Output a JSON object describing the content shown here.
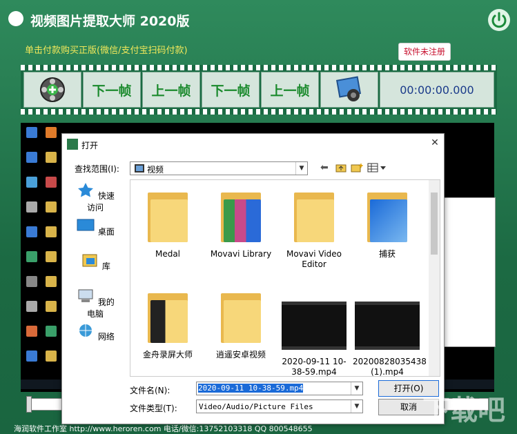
{
  "app": {
    "title": "视频图片提取大师  2020版",
    "pay_link": "单击付款购买正版(微信/支付宝扫码付款)",
    "register_badge": "软件未注册",
    "footer": "海润软件工作室 http://www.heroren.com  电话/微信:13752103318  QQ 800548655",
    "watermark": "下载吧"
  },
  "toolbar": {
    "next_frame_1": "下一帧",
    "prev_frame_1": "上一帧",
    "next_frame_2": "下一帧",
    "prev_frame_2": "上一帧",
    "timecode": "00:00:00.000"
  },
  "dialog": {
    "title": "打开",
    "look_in_label": "查找范围(I):",
    "look_in_value": "视频",
    "places": [
      "快速访问",
      "桌面",
      "库",
      "我的电脑",
      "网络"
    ],
    "files": [
      "Medal",
      "Movavi Library",
      "Movavi Video Editor",
      "捕获",
      "金舟录屏大师",
      "逍遥安卓视频",
      "2020-09-11 10-38-59.mp4",
      "20200828035438 (1).mp4"
    ],
    "filename_label": "文件名(N):",
    "filename_value": "2020-09-11 10-38-59.mp4",
    "filetype_label": "文件类型(T):",
    "filetype_value": "Video/Audio/Picture Files",
    "open_button": "打开(O)",
    "cancel_button": "取消"
  },
  "colors": {
    "app_green": "#1c6a43",
    "pay_link_yellow": "#f2e85a",
    "register_red": "#c8102e",
    "frame_text_green": "#1b8a2d"
  }
}
